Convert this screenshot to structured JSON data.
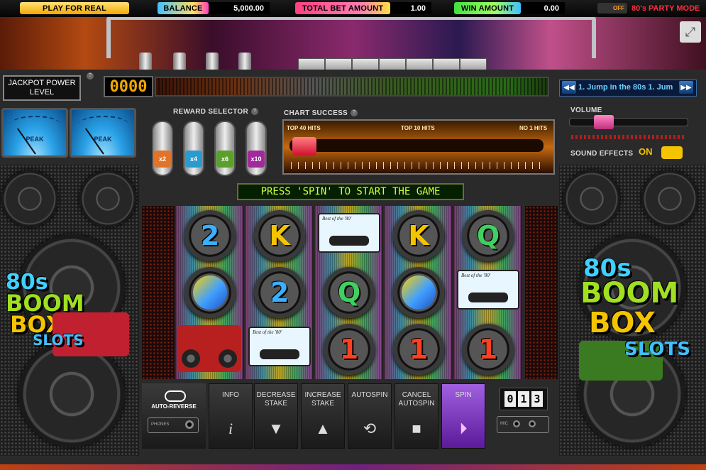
{
  "topbar": {
    "play_real": "PLAY FOR REAL",
    "balance_label": "BALANCE",
    "balance_value": "5,000.00",
    "total_bet_label": "TOTAL BET AMOUNT",
    "total_bet_value": "1.00",
    "win_label": "WIN AMOUNT",
    "win_value": "0.00",
    "party_toggle": "OFF",
    "party_mode": "80's PARTY MODE"
  },
  "jackpot": {
    "label": "JACKPOT POWER LEVEL",
    "digits": "0000"
  },
  "track": {
    "text": "1. Jump in the 80s 1. Jum"
  },
  "reward_selector": {
    "label": "REWARD SELECTOR",
    "multipliers": [
      "x2",
      "x4",
      "x6",
      "x10"
    ],
    "colors": [
      "#e0742a",
      "#2a9ad0",
      "#5aa02a",
      "#a02a9a"
    ]
  },
  "chart_success": {
    "label": "CHART SUCCESS",
    "left": "TOP 40 HITS",
    "mid": "TOP 10 HITS",
    "right": "NO 1 HITS"
  },
  "volume": {
    "label": "VOLUME",
    "level": 0.25
  },
  "sound_effects": {
    "label": "SOUND EFFECTS",
    "state": "ON"
  },
  "banner": "PRESS 'SPIN' TO START THE GAME",
  "reels": {
    "tape_text": "Best of the '80'",
    "columns": [
      [
        "2",
        "disc",
        "boombox"
      ],
      [
        "K",
        "2",
        "tape"
      ],
      [
        "tape",
        "Q",
        "1"
      ],
      [
        "K",
        "disc",
        "1"
      ],
      [
        "Q",
        "tape",
        "1"
      ]
    ],
    "symbol_colors": {
      "2": "#3ab0ff",
      "K": "#f5c400",
      "Q": "#40d060",
      "1": "#ff4020"
    }
  },
  "logo": {
    "line1": "80s",
    "line2": "BOOM",
    "line3": "BOX",
    "line4": "SLOTS"
  },
  "controls": {
    "auto_reverse": "AUTO-REVERSE",
    "phones": "PHONES",
    "info": "INFO",
    "decrease": "DECREASE STAKE",
    "increase": "INCREASE STAKE",
    "autospin": "AUTOSPIN",
    "cancel_autospin": "CANCEL AUTOSPIN",
    "spin": "SPIN",
    "counter": [
      "0",
      "1",
      "3"
    ],
    "mic": "MIC"
  },
  "meter_label": "PEAK"
}
